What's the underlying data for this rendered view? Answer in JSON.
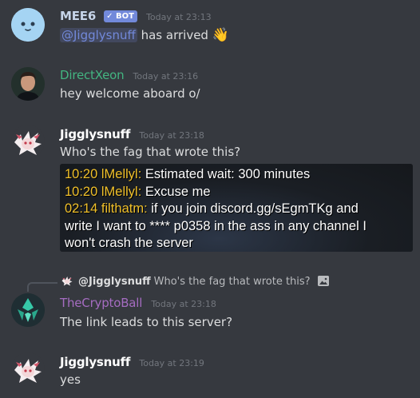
{
  "colors": {
    "mee6": "#a5b9d2",
    "directxeon": "#43b581",
    "jigglysnuff": "#ffffff",
    "cryptoball": "#9b59b6",
    "embed_highlight": "#f0c02a"
  },
  "messages": [
    {
      "author": "MEE6",
      "badge": "✓ BOT",
      "timestamp": "Today at 23:13",
      "mention": "@Jigglysnuff",
      "text": " has arrived ",
      "emoji": "👋",
      "avatar_icon": "mee6-face-icon"
    },
    {
      "author": "DirectXeon",
      "timestamp": "Today at 23:16",
      "text": "hey welcome aboard o/",
      "avatar_icon": "person-photo-icon"
    },
    {
      "author": "Jigglysnuff",
      "timestamp": "Today at 23:18",
      "text": "Who's the fag that wrote this?",
      "avatar_icon": "anime-character-icon",
      "attachment_lines": [
        {
          "time": "10:20",
          "nick": "lMellyl:",
          "text": " Estimated wait: 300 minutes"
        },
        {
          "time": "10:20",
          "nick": "lMellyl:",
          "text": " Excuse me"
        },
        {
          "time": "02:14",
          "nick": "filthatm:",
          "text": " if you join discord.gg/sEgmTKg and"
        },
        {
          "time": "",
          "nick": "",
          "text": "write I want to **** p0358 in the ass in any channel I"
        },
        {
          "time": "",
          "nick": "",
          "text": "won't crash the server"
        }
      ]
    },
    {
      "reply_to": {
        "author": "@Jigglysnuff",
        "text": "Who's the fag that wrote this?",
        "icon": "image-icon"
      },
      "author": "TheCryptoBall",
      "timestamp": "Today at 23:18",
      "text": "The link leads to this server?",
      "avatar_icon": "crypto-ball-icon"
    },
    {
      "author": "Jigglysnuff",
      "timestamp": "Today at 23:19",
      "text": "yes",
      "avatar_icon": "anime-character-icon"
    }
  ]
}
